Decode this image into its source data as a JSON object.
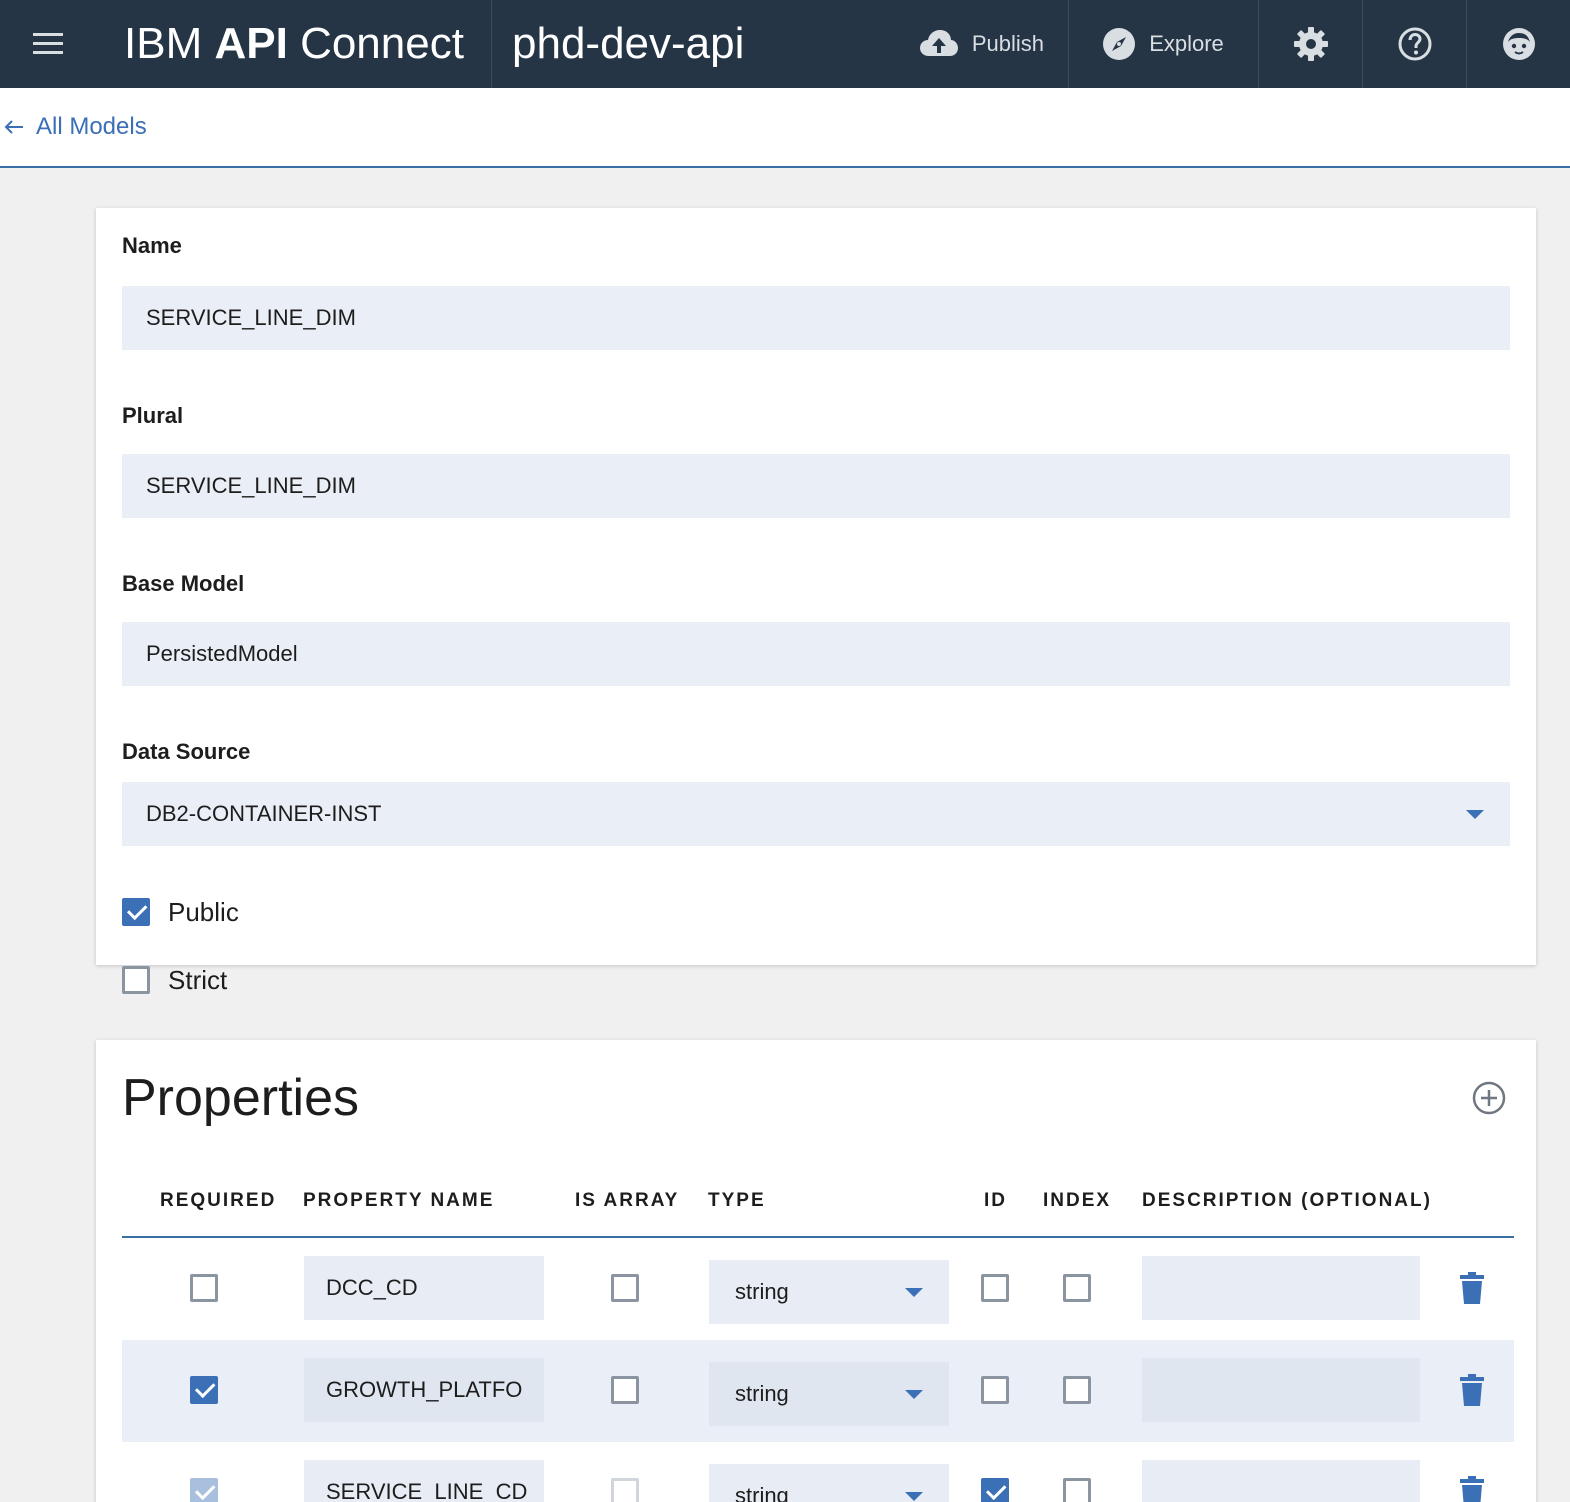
{
  "header": {
    "brand_prefix": "IBM",
    "brand_bold": "API",
    "brand_suffix": "Connect",
    "app_name": "phd-dev-api",
    "publish_label": "Publish",
    "explore_label": "Explore"
  },
  "nav": {
    "back_label": "All Models"
  },
  "model": {
    "name_label": "Name",
    "name_value": "SERVICE_LINE_DIM",
    "plural_label": "Plural",
    "plural_value": "SERVICE_LINE_DIM",
    "base_model_label": "Base Model",
    "base_model_value": "PersistedModel",
    "data_source_label": "Data Source",
    "data_source_value": "DB2-CONTAINER-INST",
    "public_label": "Public",
    "public_checked": true,
    "strict_label": "Strict",
    "strict_checked": false
  },
  "properties": {
    "title": "Properties",
    "columns": {
      "required": "REQUIRED",
      "property_name": "PROPERTY NAME",
      "is_array": "IS ARRAY",
      "type": "TYPE",
      "id": "ID",
      "index": "INDEX",
      "description": "DESCRIPTION (OPTIONAL)"
    },
    "rows": [
      {
        "required": false,
        "name": "DCC_CD",
        "is_array": false,
        "type": "string",
        "id": false,
        "index": false,
        "description": ""
      },
      {
        "required": true,
        "name": "GROWTH_PLATFO",
        "is_array": false,
        "type": "string",
        "id": false,
        "index": false,
        "description": ""
      },
      {
        "required": true,
        "name": "SERVICE_LINE_CD",
        "is_array": false,
        "type": "string",
        "id": true,
        "index": false,
        "description": ""
      }
    ]
  },
  "colors": {
    "header_bg": "#253545",
    "accent": "#3b6fb6",
    "input_bg": "#eaeff7"
  }
}
